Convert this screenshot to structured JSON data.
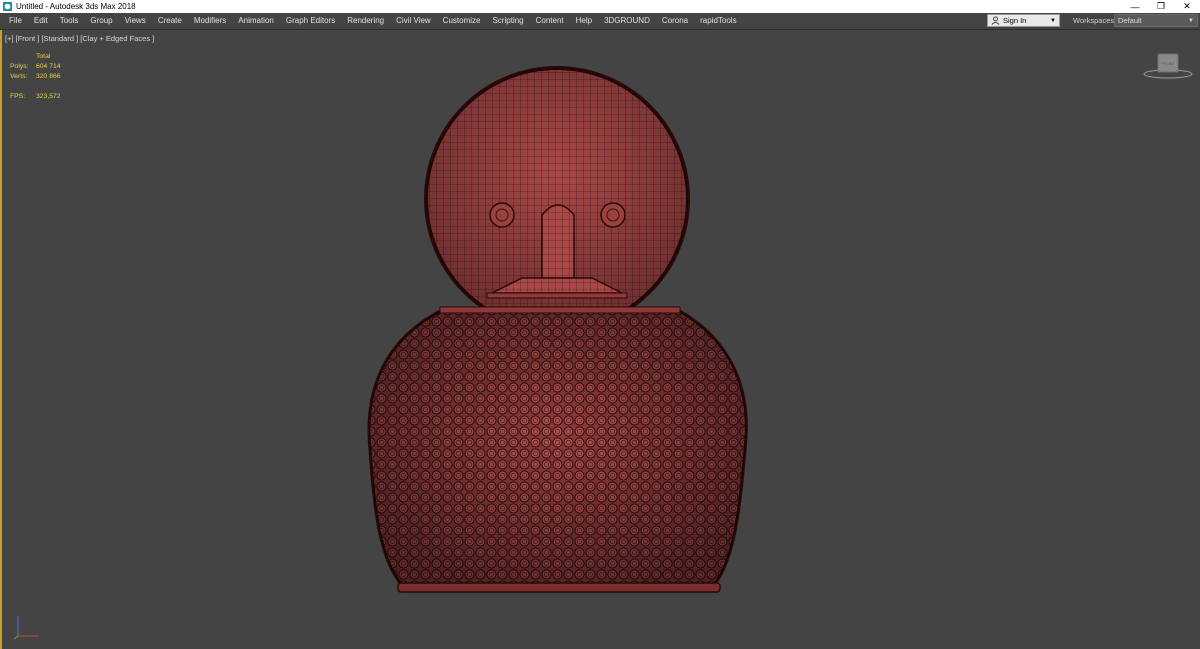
{
  "window": {
    "title": "Untitled - Autodesk 3ds Max 2018",
    "controls": {
      "minimize": "—",
      "restore": "❐",
      "close": "✕"
    }
  },
  "menu": {
    "items": [
      "File",
      "Edit",
      "Tools",
      "Group",
      "Views",
      "Create",
      "Modifiers",
      "Animation",
      "Graph Editors",
      "Rendering",
      "Civil View",
      "Customize",
      "Scripting",
      "Content",
      "Help",
      "3DGROUND",
      "Corona",
      "rapidTools"
    ],
    "signin_label": "Sign In",
    "workspaces_label": "Workspaces:",
    "workspaces_value": "Default"
  },
  "viewport": {
    "label": "[+] [Front ] [Standard ] [Clay + Edged Faces ]",
    "stats": {
      "header": "Total",
      "polys_label": "Polys:",
      "polys_value": "604 714",
      "verts_label": "Verts:",
      "verts_value": "320 866",
      "fps_label": "FPS:",
      "fps_value": "323,572"
    },
    "viewcube_label": "FRONT"
  },
  "icons": {
    "app": "3dsmax-icon",
    "user": "user-icon",
    "dropdown": "chevron-down-icon",
    "axis": "axis-tripod-icon"
  },
  "colors": {
    "viewport_bg": "#444444",
    "model_fill": "#a84848",
    "wire": "#3a1010",
    "stats_text": "#e8d04a",
    "active_border": "#c9a227"
  }
}
